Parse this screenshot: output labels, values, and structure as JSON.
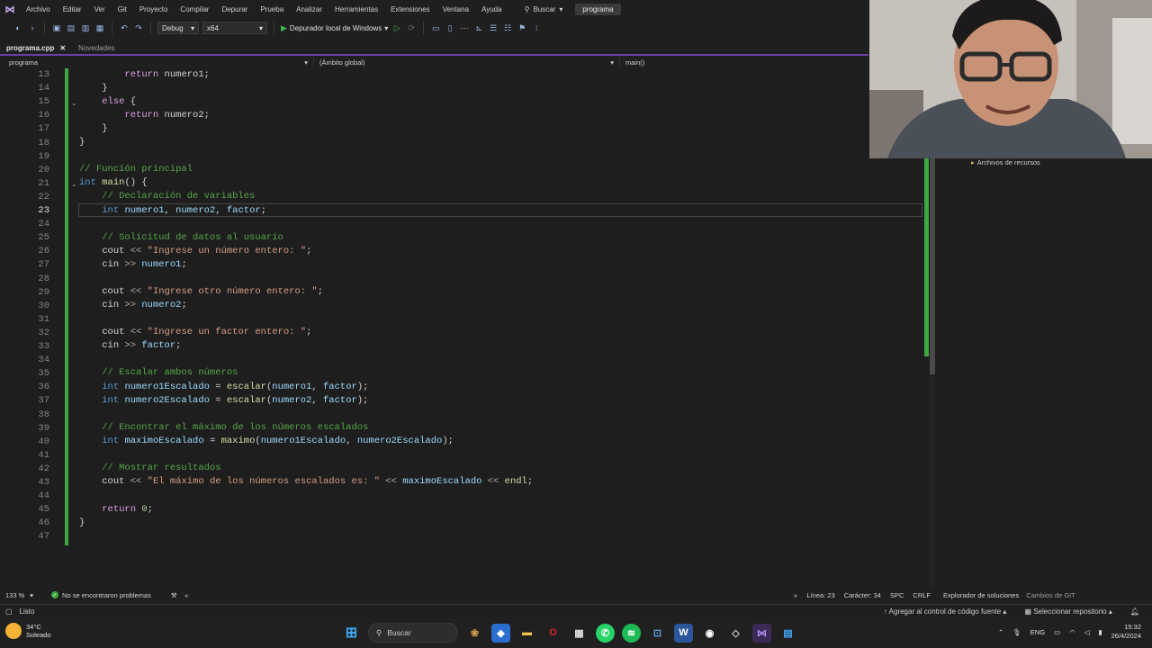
{
  "menubar": {
    "items": [
      "Archivo",
      "Editar",
      "Ver",
      "Git",
      "Proyecto",
      "Compilar",
      "Depurar",
      "Prueba",
      "Analizar",
      "Herramientas",
      "Extensiones",
      "Ventana",
      "Ayuda"
    ],
    "search_label": "Buscar",
    "project_name": "programa"
  },
  "toolbar": {
    "config": "Debug",
    "platform": "x64",
    "run_label": "Depurador local de Windows"
  },
  "tabs": {
    "active": "programa.cpp",
    "other": "Novedades"
  },
  "navbar": {
    "project": "programa",
    "scope": "(Ámbito global)",
    "member": "main()"
  },
  "editor": {
    "current_line": 23,
    "line_numbers": [
      13,
      14,
      15,
      16,
      17,
      18,
      19,
      20,
      21,
      22,
      23,
      24,
      25,
      26,
      27,
      28,
      29,
      30,
      31,
      32,
      33,
      34,
      35,
      36,
      37,
      38,
      39,
      40,
      41,
      42,
      43,
      44,
      45,
      46,
      47
    ],
    "code": {
      "l13": [
        "        ",
        "return",
        " numero1;"
      ],
      "l14": "    }",
      "l15": [
        "    ",
        "else",
        " {"
      ],
      "l16": [
        "        ",
        "return",
        " numero2;"
      ],
      "l17": "    }",
      "l18": "}",
      "l20": "// Función principal",
      "l21": [
        "int",
        " ",
        "main",
        "() {"
      ],
      "l22": "    // Declaración de variables",
      "l23": [
        "    ",
        "int",
        " ",
        "numero1",
        ", ",
        "numero2",
        ", ",
        "factor",
        ";"
      ],
      "l25": "    // Solicitud de datos al usuario",
      "l26": [
        "    ",
        "cout",
        " << ",
        "\"Ingrese un número entero: \"",
        ";"
      ],
      "l27": [
        "    ",
        "cin",
        " >> ",
        "numero1",
        ";"
      ],
      "l29": [
        "    ",
        "cout",
        " << ",
        "\"Ingrese otro número entero: \"",
        ";"
      ],
      "l30": [
        "    ",
        "cin",
        " >> ",
        "numero2",
        ";"
      ],
      "l32": [
        "    ",
        "cout",
        " << ",
        "\"Ingrese un factor entero: \"",
        ";"
      ],
      "l33": [
        "    ",
        "cin",
        " >> ",
        "factor",
        ";"
      ],
      "l35": "    // Escalar ambos números",
      "l36": [
        "    ",
        "int",
        " ",
        "numero1Escalado",
        " = ",
        "escalar",
        "(",
        "numero1",
        ", ",
        "factor",
        ");"
      ],
      "l37": [
        "    ",
        "int",
        " ",
        "numero2Escalado",
        " = ",
        "escalar",
        "(",
        "numero2",
        ", ",
        "factor",
        ");"
      ],
      "l39": "    // Encontrar el máximo de los números escalados",
      "l40": [
        "    ",
        "int",
        " ",
        "maximoEscalado",
        " = ",
        "maximo",
        "(",
        "numero1Escalado",
        ", ",
        "numero2Escalado",
        ");"
      ],
      "l42": "    // Mostrar resultados",
      "l43": [
        "    ",
        "cout",
        " << ",
        "\"El máximo de los números escalados es: \"",
        " << ",
        "maximoEscalado",
        " << ",
        "endl",
        ";"
      ],
      "l45": [
        "    ",
        "return",
        " ",
        "0",
        ";"
      ],
      "l46": "}"
    }
  },
  "side_panel": {
    "resource_label": "Archivos de recursos"
  },
  "editor_status": {
    "zoom": "133 %",
    "issues": "No se encontraron problemas",
    "line": "Línea: 23",
    "col": "Carácter: 34",
    "spc": "SPC",
    "eol": "CRLF"
  },
  "panel_tabs": {
    "solution_explorer": "Explorador de soluciones",
    "git_changes": "Cambios de GIT"
  },
  "status": {
    "ready": "Listo",
    "add_source": "Agregar al control de código fuente",
    "select_repo": "Seleccionar repositorio"
  },
  "taskbar": {
    "temperature": "34°C",
    "weather": "Soleado",
    "search": "Buscar",
    "lang": "ENG",
    "time": "15:32",
    "date": "26/4/2024"
  }
}
